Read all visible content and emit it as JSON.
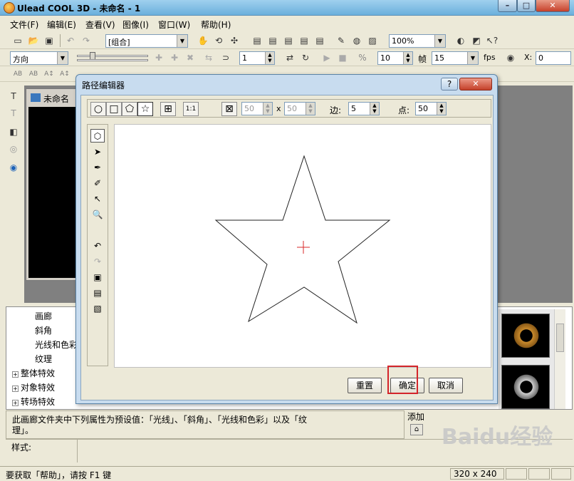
{
  "window": {
    "title": "Ulead COOL 3D - 未命名 - 1",
    "min": "–",
    "max": "□",
    "close": "✕"
  },
  "menu": [
    "文件(F)",
    "编辑(E)",
    "查看(V)",
    "图像(I)",
    "窗口(W)",
    "帮助(H)"
  ],
  "toolbar1": {
    "group_combo": "[组合]",
    "zoom_combo": "100%"
  },
  "toolbar2": {
    "direction_combo": "方向",
    "frame_value": "1",
    "fps_value": "10",
    "frame_label": "帧",
    "frame_count": "15",
    "fps_label": "fps",
    "x_label": "X:",
    "x_value": "0"
  },
  "toolbar3": {
    "text_buttons": [
      "AB",
      "AB",
      "A↕",
      "A↕"
    ]
  },
  "document": {
    "title": "未命名"
  },
  "gallery": {
    "tree": [
      {
        "label": "画廊",
        "expandable": false
      },
      {
        "label": "斜角",
        "expandable": false
      },
      {
        "label": "光线和色彩",
        "expandable": false
      },
      {
        "label": "纹理",
        "expandable": false
      },
      {
        "label": "整体特效",
        "expandable": true
      },
      {
        "label": "对象特效",
        "expandable": true
      },
      {
        "label": "转场特效",
        "expandable": true
      }
    ]
  },
  "description": {
    "line1": "此画廊文件夹中下列属性为预设值：「光线」、「斜角」、「光线和色彩」以及「纹",
    "line2": "理」。",
    "add_label": "添加"
  },
  "properties": {
    "style_label": "样式:"
  },
  "status": {
    "help_text": "要获取「帮助」，请按 F1 键",
    "size": "320 x 240"
  },
  "dialog": {
    "title": "路径编辑器",
    "help": "?",
    "close": "✕",
    "width_value": "50",
    "x_sep": "x",
    "height_value": "50",
    "sides_label": "边:",
    "sides_value": "5",
    "points_label": "点:",
    "points_value": "50",
    "btn_reset": "重置",
    "btn_ok": "确定",
    "btn_cancel": "取消"
  },
  "watermark": {
    "text": "Baidu经验"
  },
  "colors": {
    "ok_highlight": "#d4252a",
    "star_center": "#d8282a"
  }
}
